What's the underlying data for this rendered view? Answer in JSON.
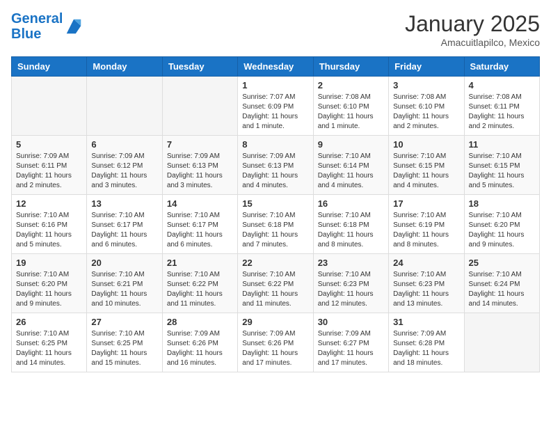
{
  "header": {
    "logo_line1": "General",
    "logo_line2": "Blue",
    "month": "January 2025",
    "location": "Amacuitlapilco, Mexico"
  },
  "weekdays": [
    "Sunday",
    "Monday",
    "Tuesday",
    "Wednesday",
    "Thursday",
    "Friday",
    "Saturday"
  ],
  "weeks": [
    [
      {
        "day": "",
        "info": ""
      },
      {
        "day": "",
        "info": ""
      },
      {
        "day": "",
        "info": ""
      },
      {
        "day": "1",
        "info": "Sunrise: 7:07 AM\nSunset: 6:09 PM\nDaylight: 11 hours and 1 minute."
      },
      {
        "day": "2",
        "info": "Sunrise: 7:08 AM\nSunset: 6:10 PM\nDaylight: 11 hours and 1 minute."
      },
      {
        "day": "3",
        "info": "Sunrise: 7:08 AM\nSunset: 6:10 PM\nDaylight: 11 hours and 2 minutes."
      },
      {
        "day": "4",
        "info": "Sunrise: 7:08 AM\nSunset: 6:11 PM\nDaylight: 11 hours and 2 minutes."
      }
    ],
    [
      {
        "day": "5",
        "info": "Sunrise: 7:09 AM\nSunset: 6:11 PM\nDaylight: 11 hours and 2 minutes."
      },
      {
        "day": "6",
        "info": "Sunrise: 7:09 AM\nSunset: 6:12 PM\nDaylight: 11 hours and 3 minutes."
      },
      {
        "day": "7",
        "info": "Sunrise: 7:09 AM\nSunset: 6:13 PM\nDaylight: 11 hours and 3 minutes."
      },
      {
        "day": "8",
        "info": "Sunrise: 7:09 AM\nSunset: 6:13 PM\nDaylight: 11 hours and 4 minutes."
      },
      {
        "day": "9",
        "info": "Sunrise: 7:10 AM\nSunset: 6:14 PM\nDaylight: 11 hours and 4 minutes."
      },
      {
        "day": "10",
        "info": "Sunrise: 7:10 AM\nSunset: 6:15 PM\nDaylight: 11 hours and 4 minutes."
      },
      {
        "day": "11",
        "info": "Sunrise: 7:10 AM\nSunset: 6:15 PM\nDaylight: 11 hours and 5 minutes."
      }
    ],
    [
      {
        "day": "12",
        "info": "Sunrise: 7:10 AM\nSunset: 6:16 PM\nDaylight: 11 hours and 5 minutes."
      },
      {
        "day": "13",
        "info": "Sunrise: 7:10 AM\nSunset: 6:17 PM\nDaylight: 11 hours and 6 minutes."
      },
      {
        "day": "14",
        "info": "Sunrise: 7:10 AM\nSunset: 6:17 PM\nDaylight: 11 hours and 6 minutes."
      },
      {
        "day": "15",
        "info": "Sunrise: 7:10 AM\nSunset: 6:18 PM\nDaylight: 11 hours and 7 minutes."
      },
      {
        "day": "16",
        "info": "Sunrise: 7:10 AM\nSunset: 6:18 PM\nDaylight: 11 hours and 8 minutes."
      },
      {
        "day": "17",
        "info": "Sunrise: 7:10 AM\nSunset: 6:19 PM\nDaylight: 11 hours and 8 minutes."
      },
      {
        "day": "18",
        "info": "Sunrise: 7:10 AM\nSunset: 6:20 PM\nDaylight: 11 hours and 9 minutes."
      }
    ],
    [
      {
        "day": "19",
        "info": "Sunrise: 7:10 AM\nSunset: 6:20 PM\nDaylight: 11 hours and 9 minutes."
      },
      {
        "day": "20",
        "info": "Sunrise: 7:10 AM\nSunset: 6:21 PM\nDaylight: 11 hours and 10 minutes."
      },
      {
        "day": "21",
        "info": "Sunrise: 7:10 AM\nSunset: 6:22 PM\nDaylight: 11 hours and 11 minutes."
      },
      {
        "day": "22",
        "info": "Sunrise: 7:10 AM\nSunset: 6:22 PM\nDaylight: 11 hours and 11 minutes."
      },
      {
        "day": "23",
        "info": "Sunrise: 7:10 AM\nSunset: 6:23 PM\nDaylight: 11 hours and 12 minutes."
      },
      {
        "day": "24",
        "info": "Sunrise: 7:10 AM\nSunset: 6:23 PM\nDaylight: 11 hours and 13 minutes."
      },
      {
        "day": "25",
        "info": "Sunrise: 7:10 AM\nSunset: 6:24 PM\nDaylight: 11 hours and 14 minutes."
      }
    ],
    [
      {
        "day": "26",
        "info": "Sunrise: 7:10 AM\nSunset: 6:25 PM\nDaylight: 11 hours and 14 minutes."
      },
      {
        "day": "27",
        "info": "Sunrise: 7:10 AM\nSunset: 6:25 PM\nDaylight: 11 hours and 15 minutes."
      },
      {
        "day": "28",
        "info": "Sunrise: 7:09 AM\nSunset: 6:26 PM\nDaylight: 11 hours and 16 minutes."
      },
      {
        "day": "29",
        "info": "Sunrise: 7:09 AM\nSunset: 6:26 PM\nDaylight: 11 hours and 17 minutes."
      },
      {
        "day": "30",
        "info": "Sunrise: 7:09 AM\nSunset: 6:27 PM\nDaylight: 11 hours and 17 minutes."
      },
      {
        "day": "31",
        "info": "Sunrise: 7:09 AM\nSunset: 6:28 PM\nDaylight: 11 hours and 18 minutes."
      },
      {
        "day": "",
        "info": ""
      }
    ]
  ]
}
